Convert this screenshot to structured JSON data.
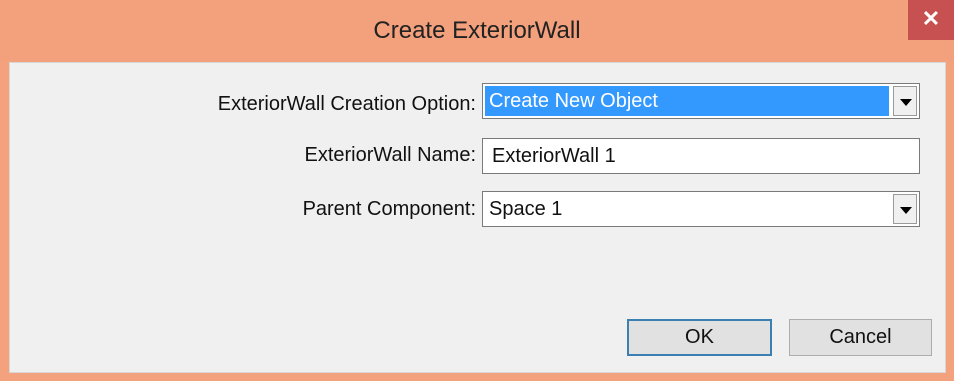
{
  "window": {
    "title": "Create ExteriorWall",
    "close_glyph": "✕",
    "accent_color": "#f3a07c",
    "close_color": "#c75050"
  },
  "form": {
    "creation_option_label": "ExteriorWall Creation Option:",
    "creation_option_value": "Create New Object",
    "name_label": "ExteriorWall Name:",
    "name_value": "ExteriorWall 1",
    "parent_label": "Parent Component:",
    "parent_value": "Space 1"
  },
  "buttons": {
    "ok_label": "OK",
    "cancel_label": "Cancel"
  },
  "icons": {
    "close": "close-icon",
    "dropdown": "chevron-down-icon"
  }
}
